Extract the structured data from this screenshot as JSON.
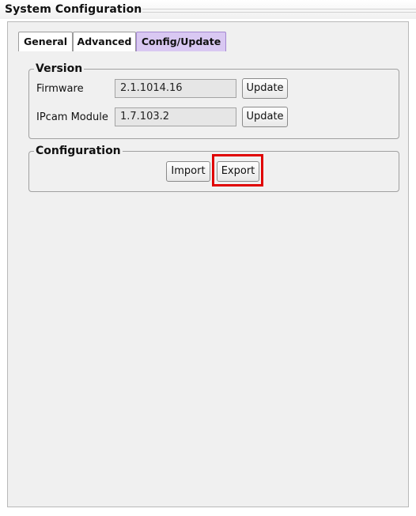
{
  "window": {
    "title": "System Configuration"
  },
  "tabs": [
    {
      "label": "General",
      "active": false
    },
    {
      "label": "Advanced",
      "active": false
    },
    {
      "label": "Config/Update",
      "active": true
    }
  ],
  "version_group": {
    "title": "Version",
    "rows": [
      {
        "label": "Firmware",
        "value": "2.1.1014.16",
        "button": "Update"
      },
      {
        "label": "IPcam Module",
        "value": "1.7.103.2",
        "button": "Update"
      }
    ]
  },
  "config_group": {
    "title": "Configuration",
    "import_label": "Import",
    "export_label": "Export"
  },
  "colors": {
    "active_tab": "#d9c8f2",
    "panel": "#f0f0f0",
    "highlight": "#e00000"
  }
}
